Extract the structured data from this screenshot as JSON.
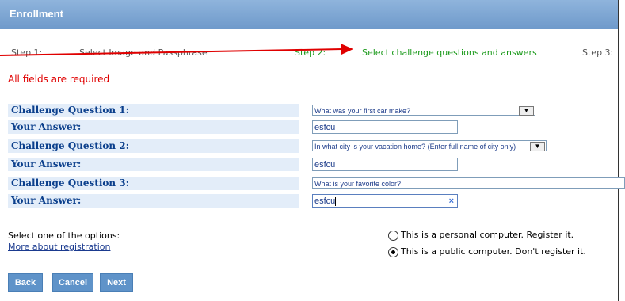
{
  "header": {
    "title": "Enrollment"
  },
  "steps": {
    "step1_num": "Step 1:",
    "step1_label": "Select Image and Passphrase",
    "step2_num": "Step 2:",
    "step2_label": "Select challenge questions and answers",
    "step3_num": "Step 3:"
  },
  "notice": "All fields are required",
  "questions": [
    {
      "label": "Challenge Question 1:",
      "selected": "What was your first car make?"
    },
    {
      "label": "Challenge Question 2:",
      "selected": "In what city is your vacation home? (Enter full name of city only)"
    },
    {
      "label": "Challenge Question 3:",
      "selected": "What is your favorite color?"
    }
  ],
  "answers": [
    {
      "label": "Your Answer:",
      "value": "esfcu"
    },
    {
      "label": "Your Answer:",
      "value": "esfcu"
    },
    {
      "label": "Your Answer:",
      "value": "esfcu"
    }
  ],
  "options": {
    "prompt": "Select one of the options:",
    "more_link": "More about registration",
    "personal": "This is a personal computer. Register it.",
    "public": "This is a public computer. Don't register it.",
    "selected": "public"
  },
  "buttons": {
    "back": "Back",
    "cancel": "Cancel",
    "next": "Next"
  },
  "colors": {
    "header": "#6f9acb",
    "label_bg": "#e3edf9",
    "label_text": "#0b3f8c",
    "required": "#e00000",
    "active_step": "#1b9a1b",
    "arrow": "#e00000"
  },
  "icons": {
    "clear": "clear-x-icon",
    "dropdown": "dropdown-arrow-icon",
    "annotation": "red-arrow-icon"
  }
}
